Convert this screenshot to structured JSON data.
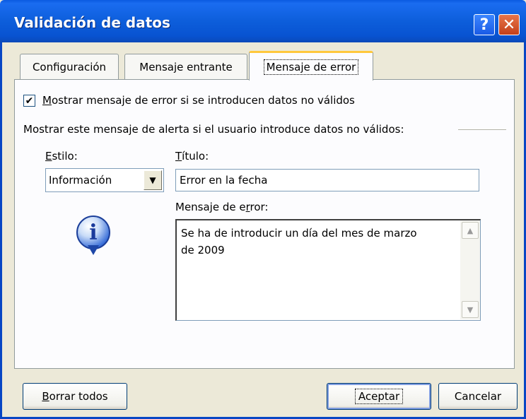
{
  "window": {
    "title": "Validación de datos",
    "help_label": "?",
    "close_label": "✕"
  },
  "tabs": [
    {
      "label": "Configuración"
    },
    {
      "label": "Mensaje entrante"
    },
    {
      "label": "Mensaje de error",
      "active": true
    }
  ],
  "form": {
    "show_error_checked": true,
    "show_error_label_u": "M",
    "show_error_label_rest": "ostrar mensaje de error si se introducen datos no válidos",
    "alert_caption": "Mostrar este mensaje de alerta si el usuario introduce datos no válidos:",
    "style_label_u": "E",
    "style_label_rest": "stilo:",
    "style_value": "Información",
    "title_label_u": "T",
    "title_label_rest": "ítulo:",
    "title_value": "Error en la fecha",
    "message_label_pre": "Mensaje de e",
    "message_label_u": "r",
    "message_label_post": "ror:",
    "message_line1": "Se ha de introducir un día del mes de marzo",
    "message_line2": "de 2009",
    "icon": "information-icon"
  },
  "buttons": {
    "clear_u": "B",
    "clear_rest": "orrar todos",
    "ok": "Aceptar",
    "cancel": "Cancelar"
  },
  "colors": {
    "titlebar": "#0a5ae0",
    "dialog_bg": "#ece9d8",
    "active_tab_accent": "#ffc83c"
  }
}
